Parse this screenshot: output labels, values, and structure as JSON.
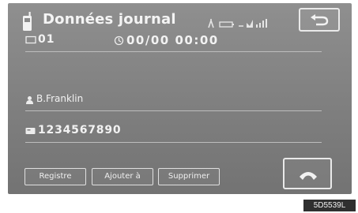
{
  "header": {
    "title": "Données journal",
    "phone_icon": "mobile-phone-icon",
    "status_icons": [
      "antenna-icon",
      "battery-icon",
      "signal-strength-icon"
    ],
    "back_icon": "back-arrow-icon"
  },
  "record": {
    "entry_number": "01",
    "datetime": "00/00  00:00",
    "name": "B.Franklin",
    "phone_number": "1234567890"
  },
  "buttons": {
    "registre": "Registre",
    "ajouter": "Ajouter à",
    "supprimer": "Supprimer",
    "call_icon": "handset-icon"
  },
  "watermark": "5D5539L"
}
